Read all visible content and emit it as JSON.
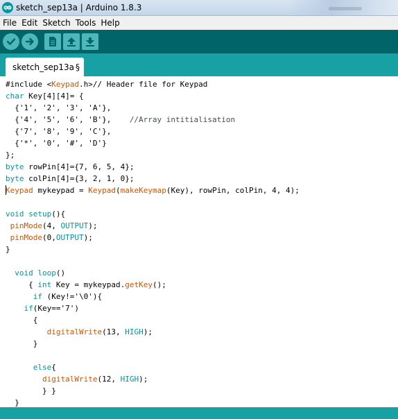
{
  "window": {
    "title": "sketch_sep13a | Arduino 1.8.3"
  },
  "menu": {
    "items": [
      "File",
      "Edit",
      "Sketch",
      "Tools",
      "Help"
    ]
  },
  "toolbar": {
    "buttons": [
      {
        "name": "verify-button",
        "icon": "checkmark-icon"
      },
      {
        "name": "upload-button",
        "icon": "arrow-right-icon"
      },
      {
        "name": "new-button",
        "icon": "document-icon"
      },
      {
        "name": "open-button",
        "icon": "arrow-up-icon"
      },
      {
        "name": "save-button",
        "icon": "arrow-down-icon"
      }
    ]
  },
  "tabs": [
    {
      "label": "sketch_sep13a",
      "modified_marker": "§"
    }
  ],
  "colors": {
    "titlebar": "#c3d6ea",
    "menubar": "#f0f0f0",
    "toolbar": "#006468",
    "toolbar_button": "#4db7bb",
    "tabstrip": "#17a1a5",
    "keyword": "#00979c",
    "library": "#d35400"
  },
  "editor": {
    "lines": [
      [
        {
          "t": "#include <"
        },
        {
          "t": "Keypad",
          "c": "lib"
        },
        {
          "t": ".h>// Header file for Keypad"
        }
      ],
      [
        {
          "t": "char",
          "c": "type"
        },
        {
          "t": " Key[4][4]= {"
        }
      ],
      [
        {
          "t": "  {'1', '2', '3', 'A'},"
        }
      ],
      [
        {
          "t": "  {'4', '5', '6', 'B'},    "
        },
        {
          "t": "//Array intitialisation",
          "c": "comment"
        }
      ],
      [
        {
          "t": "  {'7', '8', '9', 'C'},"
        }
      ],
      [
        {
          "t": "  {'*', '0', '#', 'D'}"
        }
      ],
      [
        {
          "t": "};"
        }
      ],
      [
        {
          "t": "byte",
          "c": "type"
        },
        {
          "t": " rowPin[4]={7, 6, 5, 4};"
        }
      ],
      [
        {
          "t": "byte",
          "c": "type"
        },
        {
          "t": " colPin[4]={3, 2, 1, 0};"
        }
      ],
      [
        {
          "t": "Keypad",
          "c": "lib"
        },
        {
          "t": " mykeypad = "
        },
        {
          "t": "Keypad",
          "c": "lib"
        },
        {
          "t": "("
        },
        {
          "t": "makeKeymap",
          "c": "lib"
        },
        {
          "t": "(Key), rowPin, colPin, 4, 4);"
        }
      ],
      [
        {
          "t": ""
        }
      ],
      [
        {
          "t": "void",
          "c": "type"
        },
        {
          "t": " "
        },
        {
          "t": "setup",
          "c": "type"
        },
        {
          "t": "(){"
        }
      ],
      [
        {
          "t": " "
        },
        {
          "t": "pinMode",
          "c": "lib"
        },
        {
          "t": "(4, "
        },
        {
          "t": "OUTPUT",
          "c": "type"
        },
        {
          "t": ");"
        }
      ],
      [
        {
          "t": " "
        },
        {
          "t": "pinMode",
          "c": "lib"
        },
        {
          "t": "(0,"
        },
        {
          "t": "OUTPUT",
          "c": "type"
        },
        {
          "t": ");"
        }
      ],
      [
        {
          "t": "}"
        }
      ],
      [
        {
          "t": ""
        }
      ],
      [
        {
          "t": "  "
        },
        {
          "t": "void",
          "c": "type"
        },
        {
          "t": " "
        },
        {
          "t": "loop",
          "c": "type"
        },
        {
          "t": "()"
        }
      ],
      [
        {
          "t": "     { "
        },
        {
          "t": "int",
          "c": "type"
        },
        {
          "t": " Key = mykeypad."
        },
        {
          "t": "getKey",
          "c": "lib"
        },
        {
          "t": "();"
        }
      ],
      [
        {
          "t": "      "
        },
        {
          "t": "if",
          "c": "type"
        },
        {
          "t": " (Key!='\\0'){"
        }
      ],
      [
        {
          "t": "    "
        },
        {
          "t": "if",
          "c": "type"
        },
        {
          "t": "(Key=='7')"
        }
      ],
      [
        {
          "t": "      {"
        }
      ],
      [
        {
          "t": "         "
        },
        {
          "t": "digitalWrite",
          "c": "lib"
        },
        {
          "t": "(13, "
        },
        {
          "t": "HIGH",
          "c": "type"
        },
        {
          "t": ");"
        }
      ],
      [
        {
          "t": "      }"
        }
      ],
      [
        {
          "t": ""
        }
      ],
      [
        {
          "t": "      "
        },
        {
          "t": "else",
          "c": "type"
        },
        {
          "t": "{"
        }
      ],
      [
        {
          "t": "        "
        },
        {
          "t": "digitalWrite",
          "c": "lib"
        },
        {
          "t": "(12, "
        },
        {
          "t": "HIGH",
          "c": "type"
        },
        {
          "t": ");"
        }
      ],
      [
        {
          "t": "        } }"
        }
      ],
      [
        {
          "t": "  }"
        }
      ]
    ]
  }
}
